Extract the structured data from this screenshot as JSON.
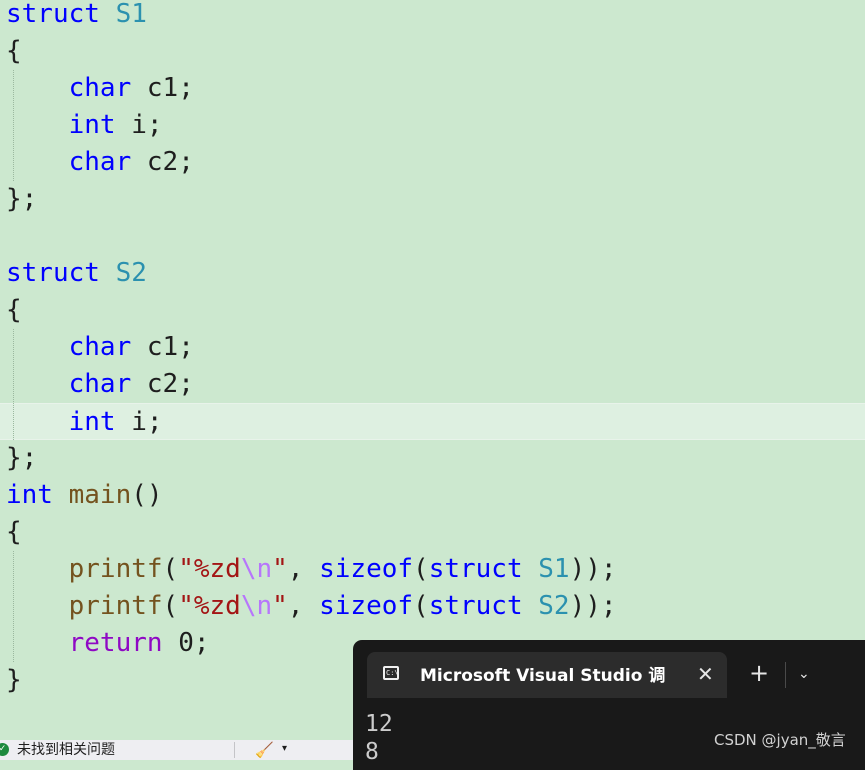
{
  "editor": {
    "colors": {
      "background": "#cce8cf",
      "keyword": "#0000ff",
      "type_name": "#2b91af",
      "function": "#74531f",
      "string": "#a31515",
      "escape": "#b776fb",
      "control": "#8f08c4",
      "plain": "#1e1e1e"
    },
    "current_line": 11,
    "lines": [
      [
        {
          "t": "struct",
          "c": "kw"
        },
        {
          "t": " "
        },
        {
          "t": "S1",
          "c": "type"
        }
      ],
      [
        {
          "t": "{"
        }
      ],
      [
        {
          "t": "    "
        },
        {
          "t": "char",
          "c": "kw"
        },
        {
          "t": " c1;"
        }
      ],
      [
        {
          "t": "    "
        },
        {
          "t": "int",
          "c": "kw"
        },
        {
          "t": " i;"
        }
      ],
      [
        {
          "t": "    "
        },
        {
          "t": "char",
          "c": "kw"
        },
        {
          "t": " c2;"
        }
      ],
      [
        {
          "t": "};"
        }
      ],
      [],
      [
        {
          "t": "struct",
          "c": "kw"
        },
        {
          "t": " "
        },
        {
          "t": "S2",
          "c": "type"
        }
      ],
      [
        {
          "t": "{"
        }
      ],
      [
        {
          "t": "    "
        },
        {
          "t": "char",
          "c": "kw"
        },
        {
          "t": " c1;"
        }
      ],
      [
        {
          "t": "    "
        },
        {
          "t": "char",
          "c": "kw"
        },
        {
          "t": " c2;"
        }
      ],
      [
        {
          "t": "    "
        },
        {
          "t": "int",
          "c": "kw"
        },
        {
          "t": " i;"
        }
      ],
      [
        {
          "t": "};"
        }
      ],
      [
        {
          "t": "int",
          "c": "kw"
        },
        {
          "t": " "
        },
        {
          "t": "main",
          "c": "fn"
        },
        {
          "t": "()"
        }
      ],
      [
        {
          "t": "{"
        }
      ],
      [
        {
          "t": "    "
        },
        {
          "t": "printf",
          "c": "fn"
        },
        {
          "t": "("
        },
        {
          "t": "\"%zd",
          "c": "str"
        },
        {
          "t": "\\n",
          "c": "esc"
        },
        {
          "t": "\"",
          "c": "str"
        },
        {
          "t": ", "
        },
        {
          "t": "sizeof",
          "c": "kw"
        },
        {
          "t": "("
        },
        {
          "t": "struct",
          "c": "kw"
        },
        {
          "t": " "
        },
        {
          "t": "S1",
          "c": "type"
        },
        {
          "t": "));"
        }
      ],
      [
        {
          "t": "    "
        },
        {
          "t": "printf",
          "c": "fn"
        },
        {
          "t": "("
        },
        {
          "t": "\"%zd",
          "c": "str"
        },
        {
          "t": "\\n",
          "c": "esc"
        },
        {
          "t": "\"",
          "c": "str"
        },
        {
          "t": ", "
        },
        {
          "t": "sizeof",
          "c": "kw"
        },
        {
          "t": "("
        },
        {
          "t": "struct",
          "c": "kw"
        },
        {
          "t": " "
        },
        {
          "t": "S2",
          "c": "type"
        },
        {
          "t": "));"
        }
      ],
      [
        {
          "t": "    "
        },
        {
          "t": "return",
          "c": "ctl"
        },
        {
          "t": " 0;"
        }
      ],
      [
        {
          "t": "}"
        }
      ]
    ]
  },
  "status_bar": {
    "issues_text": "未找到相关问题",
    "ok_icon": "check-circle-icon",
    "cleanup_icon": "brush-icon",
    "caret_glyph": "▾"
  },
  "terminal": {
    "tab_title": "Microsoft Visual Studio 调试控制台",
    "tab_icon": "console-icon",
    "close_glyph": "✕",
    "new_tab_glyph": "+",
    "dropdown_glyph": "⌄",
    "output": [
      "12",
      "8"
    ]
  },
  "watermark": "CSDN @jyan_敬言"
}
